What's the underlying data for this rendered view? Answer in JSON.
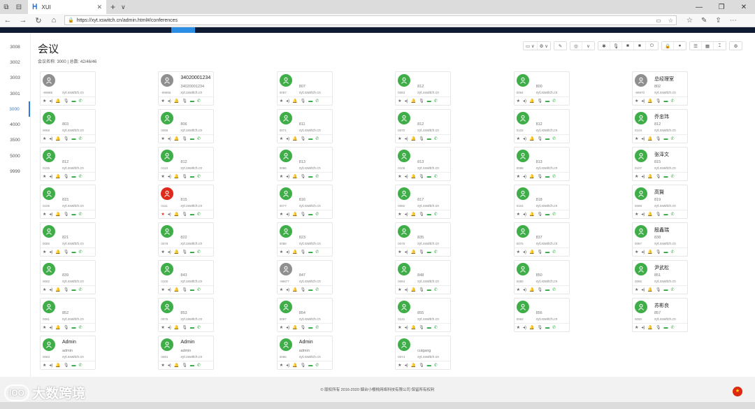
{
  "browser": {
    "tab_title": "XUI",
    "url": "https://xyt.xswitch.cn/admin.html#/conferences",
    "tab_close": "✕",
    "new_tab": "+",
    "tab_menu": "∨"
  },
  "colors": {
    "accent": "#2b7de0",
    "header": "#0f1b33",
    "online": "#3fae49",
    "offline": "#8f8f8f",
    "alert": "#e0291b"
  },
  "sidebar": {
    "items": [
      "3008",
      "3002",
      "3003",
      "3001",
      "3000",
      "4000",
      "3500",
      "5000",
      "9999"
    ],
    "active": "3000"
  },
  "page": {
    "title": "会议",
    "subtitle": "会议名称: 3000 | 总数: 42/46/46"
  },
  "toolbar": {
    "buttons": [
      "▭ ∨",
      "⚙ ∨",
      "✎",
      "◎",
      "∨",
      "✱",
      "🎙",
      "■",
      "■",
      "⏻",
      "🔒",
      "●",
      "☰",
      "▦",
      "⌶",
      "⚙"
    ]
  },
  "cards": [
    {
      "name": "",
      "ext": "",
      "num": "-99988",
      "domain": "xyt.xswitch.cn",
      "status": "offline"
    },
    {
      "name": "34020001234",
      "ext": "34020001234",
      "num": "-99955",
      "domain": "xyt.xswitch.cn",
      "status": "offline"
    },
    {
      "name": "",
      "ext": "807",
      "num": "0097",
      "domain": "xyt.xswitch.cn",
      "status": "online"
    },
    {
      "name": "",
      "ext": "812",
      "num": "0083",
      "domain": "xyt.xswitch.cn",
      "status": "online"
    },
    {
      "name": "",
      "ext": "800",
      "num": "0094",
      "domain": "xyt.xswitch.cn",
      "status": "online"
    },
    {
      "name": "总经理室",
      "ext": "802",
      "num": "-99970",
      "domain": "xyt.xswitch.cn",
      "status": "offline"
    },
    {
      "name": "",
      "ext": "803",
      "num": "0068",
      "domain": "xyt.xswitch.cn",
      "status": "online"
    },
    {
      "name": "",
      "ext": "806",
      "num": "0065",
      "domain": "xyt.xswitch.cn",
      "status": "online"
    },
    {
      "name": "",
      "ext": "811",
      "num": "0071",
      "domain": "xyt.xswitch.cn",
      "status": "online"
    },
    {
      "name": "",
      "ext": "812",
      "num": "0070",
      "domain": "xyt.xswitch.cn",
      "status": "online"
    },
    {
      "name": "",
      "ext": "812",
      "num": "0102",
      "domain": "xyt.xswitch.cn",
      "status": "online"
    },
    {
      "name": "乔忠玮",
      "ext": "812",
      "num": "0103",
      "domain": "xyt.xswitch.cn",
      "status": "online"
    },
    {
      "name": "",
      "ext": "812",
      "num": "0105",
      "domain": "xyt.xswitch.cn",
      "status": "online"
    },
    {
      "name": "",
      "ext": "812",
      "num": "0110",
      "domain": "xyt.xswitch.cn",
      "status": "online"
    },
    {
      "name": "",
      "ext": "813",
      "num": "0086",
      "domain": "xyt.xswitch.cn",
      "status": "online"
    },
    {
      "name": "",
      "ext": "813",
      "num": "0105",
      "domain": "xyt.xswitch.cn",
      "status": "online"
    },
    {
      "name": "",
      "ext": "813",
      "num": "0088",
      "domain": "xyt.xswitch.cn",
      "status": "online"
    },
    {
      "name": "张泽文",
      "ext": "815",
      "num": "0107",
      "domain": "xyt.xswitch.cn",
      "status": "online"
    },
    {
      "name": "",
      "ext": "815",
      "num": "0106",
      "domain": "xyt.xswitch.cn",
      "status": "online"
    },
    {
      "name": "",
      "ext": "815",
      "num": "0111",
      "domain": "xyt.xswitch.cn",
      "status": "alert"
    },
    {
      "name": "",
      "ext": "816",
      "num": "0077",
      "domain": "xyt.xswitch.cn",
      "status": "online"
    },
    {
      "name": "",
      "ext": "817",
      "num": "0082",
      "domain": "xyt.xswitch.cn",
      "status": "online"
    },
    {
      "name": "",
      "ext": "818",
      "num": "0104",
      "domain": "xyt.xswitch.cn",
      "status": "online"
    },
    {
      "name": "高賢",
      "ext": "819",
      "num": "0089",
      "domain": "xyt.xswitch.cn",
      "status": "online"
    },
    {
      "name": "",
      "ext": "821",
      "num": "0085",
      "domain": "xyt.xswitch.cn",
      "status": "online"
    },
    {
      "name": "",
      "ext": "822",
      "num": "0078",
      "domain": "xyt.xswitch.cn",
      "status": "online"
    },
    {
      "name": "",
      "ext": "823",
      "num": "0088",
      "domain": "xyt.xswitch.cn",
      "status": "online"
    },
    {
      "name": "",
      "ext": "835",
      "num": "0079",
      "domain": "xyt.xswitch.cn",
      "status": "online"
    },
    {
      "name": "",
      "ext": "837",
      "num": "0075",
      "domain": "xyt.xswitch.cn",
      "status": "online"
    },
    {
      "name": "殷鑫瑞",
      "ext": "838",
      "num": "0087",
      "domain": "xyt.xswitch.cn",
      "status": "online"
    },
    {
      "name": "",
      "ext": "839",
      "num": "0092",
      "domain": "xyt.xswitch.cn",
      "status": "online"
    },
    {
      "name": "",
      "ext": "843",
      "num": "0100",
      "domain": "xyt.xswitch.cn",
      "status": "online"
    },
    {
      "name": "",
      "ext": "847",
      "num": "-99877",
      "domain": "xyt.xswitch.cn",
      "status": "offline"
    },
    {
      "name": "",
      "ext": "848",
      "num": "0084",
      "domain": "xyt.xswitch.cn",
      "status": "online"
    },
    {
      "name": "",
      "ext": "850",
      "num": "0080",
      "domain": "xyt.xswitch.cn",
      "status": "online"
    },
    {
      "name": "尹武松",
      "ext": "851",
      "num": "0085",
      "domain": "xyt.xswitch.cn",
      "status": "online"
    },
    {
      "name": "",
      "ext": "852",
      "num": "0061",
      "domain": "xyt.xswitch.cn",
      "status": "online"
    },
    {
      "name": "",
      "ext": "853",
      "num": "0076",
      "domain": "xyt.xswitch.cn",
      "status": "online"
    },
    {
      "name": "",
      "ext": "854",
      "num": "0097",
      "domain": "xyt.xswitch.cn",
      "status": "online"
    },
    {
      "name": "",
      "ext": "855",
      "num": "0121",
      "domain": "xyt.xswitch.cn",
      "status": "online"
    },
    {
      "name": "",
      "ext": "856",
      "num": "0062",
      "domain": "xyt.xswitch.cn",
      "status": "online"
    },
    {
      "name": "苏彬良",
      "ext": "857",
      "num": "0090",
      "domain": "xyt.xswitch.cn",
      "status": "online"
    },
    {
      "name": "Admin",
      "ext": "admin",
      "num": "0083",
      "domain": "xyt.xswitch.cn",
      "status": "online"
    },
    {
      "name": "Admin",
      "ext": "admin",
      "num": "0081",
      "domain": "xyt.xswitch.cn",
      "status": "online"
    },
    {
      "name": "Admin",
      "ext": "admin",
      "num": "0096",
      "domain": "xyt.xswitch.cn",
      "status": "online"
    },
    {
      "name": "",
      "ext": "cuigang",
      "num": "0074",
      "domain": "xyt.xswitch.cn",
      "status": "online"
    }
  ],
  "card_icons": [
    "★",
    "◂)",
    "🔔",
    "🎙",
    "▬",
    "✆"
  ],
  "footer": {
    "text": "© 版权所有 2016-2020 烟台小樱桃网络科技有限公司 保留所有权利"
  },
  "watermark": {
    "text": "大数跨境",
    "logo": "lOO"
  },
  "locale_flag": "★"
}
